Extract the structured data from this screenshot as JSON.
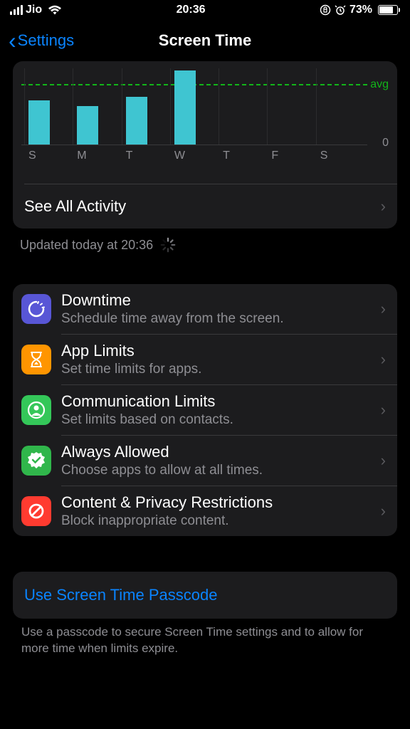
{
  "status": {
    "carrier": "Jio",
    "time": "20:36",
    "battery": "73%"
  },
  "nav": {
    "back": "Settings",
    "title": "Screen Time"
  },
  "chart_data": {
    "type": "bar",
    "categories": [
      "S",
      "M",
      "T",
      "W",
      "T",
      "F",
      "S"
    ],
    "values": [
      63,
      55,
      68,
      105,
      0,
      0,
      0
    ],
    "avg_line": 83,
    "ylim": [
      0,
      108
    ],
    "avg_label": "avg",
    "zero_label": "0"
  },
  "activity": {
    "see_all": "See All Activity",
    "updated": "Updated today at 20:36"
  },
  "list": {
    "downtime": {
      "title": "Downtime",
      "sub": "Schedule time away from the screen."
    },
    "applimits": {
      "title": "App Limits",
      "sub": "Set time limits for apps."
    },
    "comm": {
      "title": "Communication Limits",
      "sub": "Set limits based on contacts."
    },
    "always": {
      "title": "Always Allowed",
      "sub": "Choose apps to allow at all times."
    },
    "content": {
      "title": "Content & Privacy Restrictions",
      "sub": "Block inappropriate content."
    }
  },
  "passcode": {
    "action": "Use Screen Time Passcode",
    "footer": "Use a passcode to secure Screen Time settings and to allow for more time when limits expire."
  }
}
